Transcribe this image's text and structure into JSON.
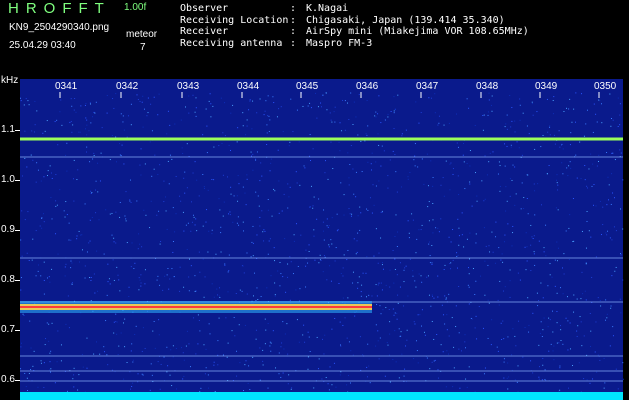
{
  "header": {
    "app_title": "HROFFT",
    "version": "1.00f",
    "filename": "KN9_2504290340.png",
    "timestamp": "25.04.29 03:40",
    "counter_label": "meteor",
    "counter_value": "7"
  },
  "info": [
    {
      "key": "Observer",
      "value": "K.Nagai"
    },
    {
      "key": "Receiving Location",
      "value": "Chigasaki, Japan (139.414 35.340)"
    },
    {
      "key": "Receiver",
      "value": "AirSpy mini (Miakejima VOR 108.65MHz)"
    },
    {
      "key": "Receiving antenna",
      "value": "Maspro FM-3"
    }
  ],
  "plot": {
    "y_unit": "kHz",
    "y_ticks": [
      "1.1",
      "1.0",
      "0.9",
      "0.8",
      "0.7",
      "0.6"
    ],
    "x_ticks": [
      "0341",
      "0342",
      "0343",
      "0344",
      "0345",
      "0346",
      "0347",
      "0348",
      "0349",
      "0350"
    ],
    "colors": {
      "background": "#0a1a8c",
      "carrier": "#9cff5a",
      "echo": "#ff3a3a",
      "baseline": "#00e5ff"
    }
  }
}
